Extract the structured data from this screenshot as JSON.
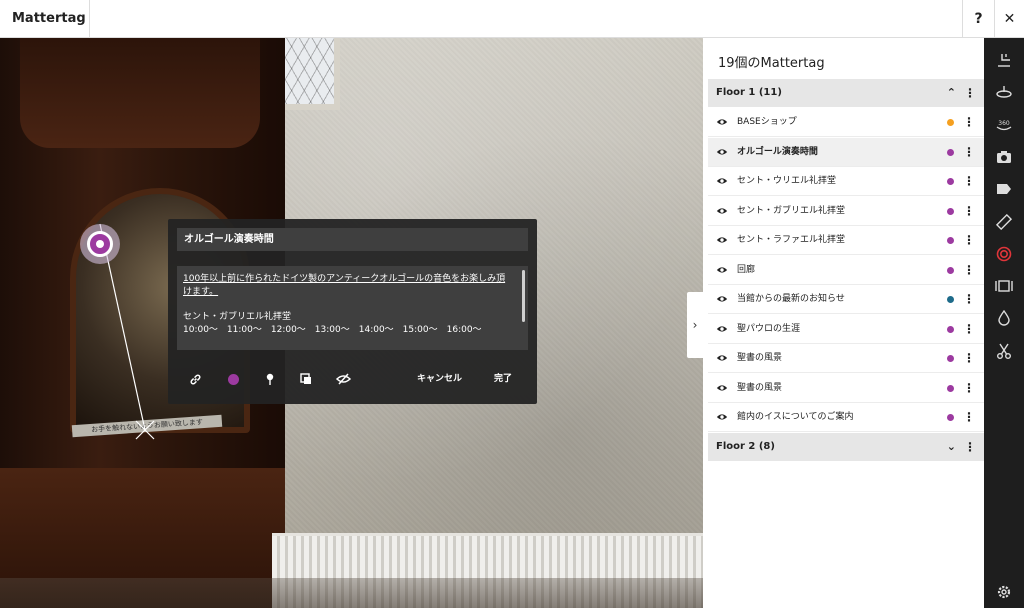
{
  "app": {
    "title": "Mattertag",
    "help_label": "?",
    "close_label": "✕"
  },
  "scene": {
    "plaque_text": "お手を触れないようお願い致します"
  },
  "editor": {
    "title": "オルゴール演奏時間",
    "description": "100年以上前に作られたドイツ製のアンティークオルゴールの音色をお楽しみ頂けます。",
    "location": "セント・ガブリエル礼拝堂",
    "times": "10:00〜　11:00〜　12:00〜　13:00〜　14:00〜　15:00〜　16:00〜",
    "cancel_label": "キャンセル",
    "done_label": "完了",
    "tag_color": "#9c3aa0",
    "tools": [
      "link-icon",
      "color-icon",
      "pin-icon",
      "media-icon",
      "visibility-icon"
    ]
  },
  "panel": {
    "title": "19個のMattertag",
    "floors": [
      {
        "label": "Floor 1 (11)",
        "expanded": true,
        "chevron": "⌃",
        "more": "⋮"
      },
      {
        "label": "Floor 2 (8)",
        "expanded": false,
        "chevron": "⌄",
        "more": "⋮"
      }
    ],
    "tags": [
      {
        "label": "BASEショップ",
        "color": "#f5a020",
        "active": false
      },
      {
        "label": "オルゴール演奏時間",
        "color": "#9c3aa0",
        "active": true
      },
      {
        "label": "セント・ウリエル礼拝堂",
        "color": "#9c3aa0",
        "active": false
      },
      {
        "label": "セント・ガブリエル礼拝堂",
        "color": "#9c3aa0",
        "active": false
      },
      {
        "label": "セント・ラファエル礼拝堂",
        "color": "#9c3aa0",
        "active": false
      },
      {
        "label": "回廊",
        "color": "#9c3aa0",
        "active": false
      },
      {
        "label": "当館からの最新のお知らせ",
        "color": "#1e6b8a",
        "active": false
      },
      {
        "label": "聖パウロの生涯",
        "color": "#9c3aa0",
        "active": false
      },
      {
        "label": "聖書の風景",
        "color": "#9c3aa0",
        "active": false
      },
      {
        "label": "聖書の風景",
        "color": "#9c3aa0",
        "active": false
      },
      {
        "label": "館内のイスについてのご案内",
        "color": "#9c3aa0",
        "active": false
      }
    ],
    "collapse_label": "›"
  },
  "toolbar": {
    "tools": [
      "floor-plan-icon",
      "highlight-reel-icon",
      "360-views-icon",
      "camera-icon",
      "labels-icon",
      "measure-icon",
      "mattertag-icon",
      "dollhouse-icon",
      "drops-icon",
      "trim-icon"
    ],
    "settings": "settings-icon",
    "active_color": "#e0353a",
    "icon_color": "#dddddd"
  }
}
